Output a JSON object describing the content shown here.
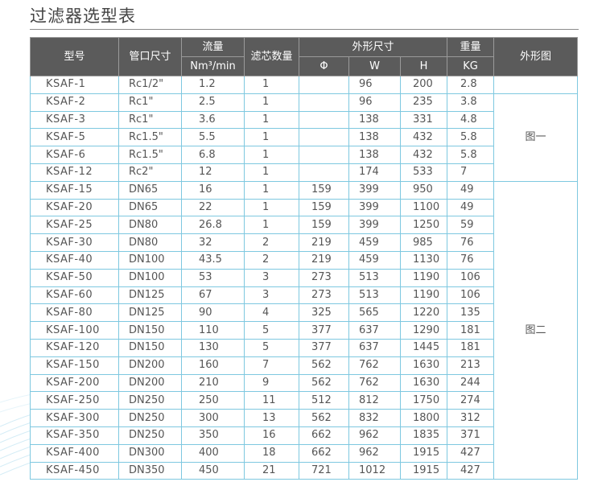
{
  "title": "过滤器选型表",
  "headers": {
    "model": "型号",
    "port": "管口尺寸",
    "flow": "流量",
    "flow_unit": "Nm³/min",
    "cores": "滤芯数量",
    "dims": "外形尺寸",
    "phi": "Φ",
    "w": "W",
    "h": "H",
    "weight": "重量",
    "weight_unit": "KG",
    "figure": "外形图"
  },
  "figures": {
    "fig1": "图一",
    "fig2": "图二"
  },
  "rows": [
    {
      "model": "KSAF-1",
      "port": "Rc1/2\"",
      "flow": "1.2",
      "cores": "1",
      "phi": "",
      "w": "96",
      "h": "200",
      "kg": "2.8"
    },
    {
      "model": "KSAF-2",
      "port": "Rc1\"",
      "flow": "2.5",
      "cores": "1",
      "phi": "",
      "w": "96",
      "h": "235",
      "kg": "3.8"
    },
    {
      "model": "KSAF-3",
      "port": "Rc1\"",
      "flow": "3.6",
      "cores": "1",
      "phi": "",
      "w": "138",
      "h": "331",
      "kg": "4.8"
    },
    {
      "model": "KSAF-5",
      "port": "Rc1.5\"",
      "flow": "5.5",
      "cores": "1",
      "phi": "",
      "w": "138",
      "h": "432",
      "kg": "5.8"
    },
    {
      "model": "KSAF-6",
      "port": "Rc1.5\"",
      "flow": "6.8",
      "cores": "1",
      "phi": "",
      "w": "138",
      "h": "432",
      "kg": "5.8"
    },
    {
      "model": "KSAF-12",
      "port": "Rc2\"",
      "flow": "12",
      "cores": "1",
      "phi": "",
      "w": "174",
      "h": "533",
      "kg": "7"
    },
    {
      "model": "KSAF-15",
      "port": "DN65",
      "flow": "16",
      "cores": "1",
      "phi": "159",
      "w": "399",
      "h": "950",
      "kg": "49"
    },
    {
      "model": "KSAF-20",
      "port": "DN65",
      "flow": "22",
      "cores": "1",
      "phi": "159",
      "w": "399",
      "h": "1100",
      "kg": "49"
    },
    {
      "model": "KSAF-25",
      "port": "DN80",
      "flow": "26.8",
      "cores": "1",
      "phi": "159",
      "w": "399",
      "h": "1250",
      "kg": "59"
    },
    {
      "model": "KSAF-30",
      "port": "DN80",
      "flow": "32",
      "cores": "2",
      "phi": "219",
      "w": "459",
      "h": "985",
      "kg": "76"
    },
    {
      "model": "KSAF-40",
      "port": "DN100",
      "flow": "43.5",
      "cores": "2",
      "phi": "219",
      "w": "459",
      "h": "1130",
      "kg": "76"
    },
    {
      "model": "KSAF-50",
      "port": "DN100",
      "flow": "53",
      "cores": "3",
      "phi": "273",
      "w": "513",
      "h": "1190",
      "kg": "106"
    },
    {
      "model": "KSAF-60",
      "port": "DN125",
      "flow": "67",
      "cores": "3",
      "phi": "273",
      "w": "513",
      "h": "1190",
      "kg": "106"
    },
    {
      "model": "KSAF-80",
      "port": "DN125",
      "flow": "90",
      "cores": "4",
      "phi": "325",
      "w": "565",
      "h": "1220",
      "kg": "135"
    },
    {
      "model": "KSAF-100",
      "port": "DN150",
      "flow": "110",
      "cores": "5",
      "phi": "377",
      "w": "637",
      "h": "1290",
      "kg": "181"
    },
    {
      "model": "KSAF-120",
      "port": "DN150",
      "flow": "130",
      "cores": "5",
      "phi": "377",
      "w": "637",
      "h": "1445",
      "kg": "181"
    },
    {
      "model": "KSAF-150",
      "port": "DN200",
      "flow": "160",
      "cores": "7",
      "phi": "562",
      "w": "762",
      "h": "1630",
      "kg": "213"
    },
    {
      "model": "KSAF-200",
      "port": "DN200",
      "flow": "210",
      "cores": "9",
      "phi": "562",
      "w": "762",
      "h": "1630",
      "kg": "244"
    },
    {
      "model": "KSAF-250",
      "port": "DN250",
      "flow": "250",
      "cores": "11",
      "phi": "512",
      "w": "812",
      "h": "1750",
      "kg": "274"
    },
    {
      "model": "KSAF-300",
      "port": "DN250",
      "flow": "300",
      "cores": "13",
      "phi": "562",
      "w": "832",
      "h": "1800",
      "kg": "312"
    },
    {
      "model": "KSAF-350",
      "port": "DN250",
      "flow": "350",
      "cores": "16",
      "phi": "662",
      "w": "962",
      "h": "1835",
      "kg": "371"
    },
    {
      "model": "KSAF-400",
      "port": "DN300",
      "flow": "400",
      "cores": "18",
      "phi": "662",
      "w": "962",
      "h": "1915",
      "kg": "427"
    },
    {
      "model": "KSAF-450",
      "port": "DN350",
      "flow": "450",
      "cores": "21",
      "phi": "721",
      "w": "1012",
      "h": "1915",
      "kg": "427"
    }
  ]
}
